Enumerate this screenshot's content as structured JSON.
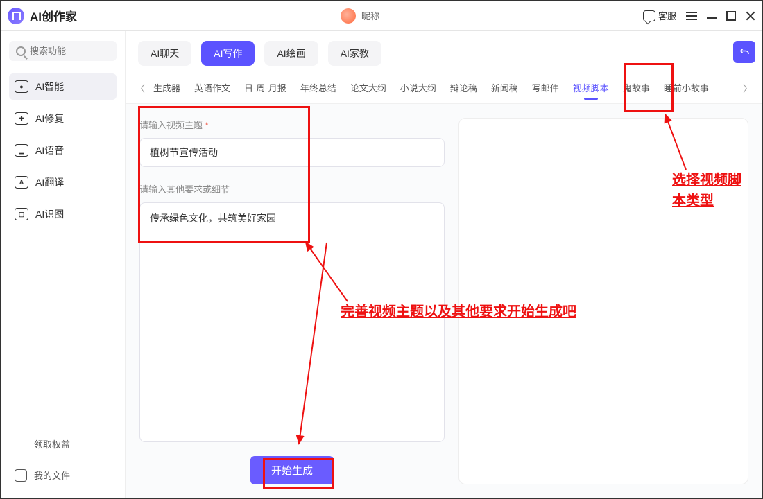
{
  "app": {
    "title": "AI创作家",
    "nickname": "昵称",
    "kefu": "客服"
  },
  "sidebar": {
    "search_placeholder": "搜索功能",
    "items": [
      {
        "label": "AI智能",
        "ico": "●"
      },
      {
        "label": "AI修复",
        "ico": "✚"
      },
      {
        "label": "AI语音",
        "ico": "▁"
      },
      {
        "label": "AI翻译",
        "ico": "A"
      },
      {
        "label": "AI识图",
        "ico": "▢"
      }
    ],
    "rights": "领取权益",
    "files": "我的文件"
  },
  "modes": [
    {
      "label": "AI聊天",
      "active": false
    },
    {
      "label": "AI写作",
      "active": true
    },
    {
      "label": "AI绘画",
      "active": false
    },
    {
      "label": "AI家教",
      "active": false
    }
  ],
  "subtabs": {
    "items": [
      "生成器",
      "英语作文",
      "日-周-月报",
      "年终总结",
      "论文大纲",
      "小说大纲",
      "辩论稿",
      "新闻稿",
      "写邮件",
      "视频脚本",
      "鬼故事",
      "睡前小故事"
    ],
    "selected": "视频脚本"
  },
  "form": {
    "topic_label": "请输入视频主题",
    "topic_value": "植树节宣传活动",
    "extra_label": "请输入其他要求或细节",
    "extra_value": "传承绿色文化，共筑美好家园",
    "submit": "开始生成"
  },
  "annotations": {
    "a1": "选择视频脚本类型",
    "a2": "完善视频主题以及其他要求开始生成吧"
  }
}
